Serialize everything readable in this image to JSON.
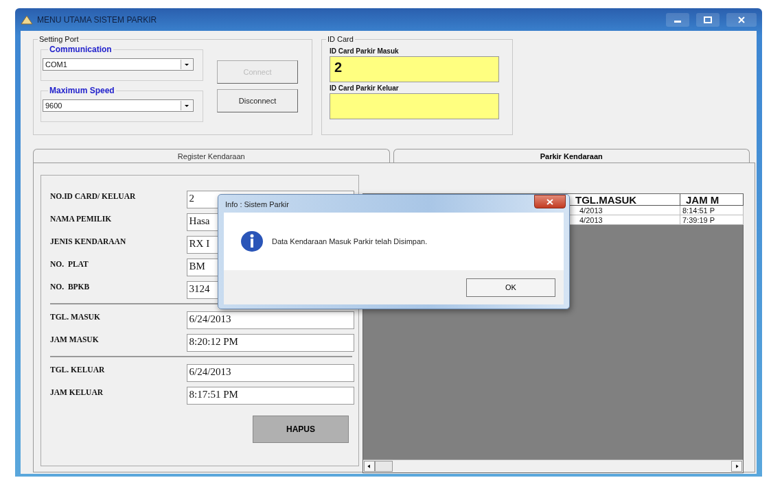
{
  "window": {
    "title": "MENU UTAMA SISTEM PARKIR"
  },
  "setting_port": {
    "title": "Setting Port",
    "communication": {
      "label": "Communication",
      "value": "COM1"
    },
    "maximum_speed": {
      "label": "Maximum Speed",
      "value": "9600"
    },
    "buttons": [
      {
        "label": "Connect",
        "disabled": true
      },
      {
        "label": "Disconnect",
        "disabled": false
      }
    ]
  },
  "id_card": {
    "title": "ID Card",
    "fields": [
      {
        "label": "ID Card Parkir Masuk",
        "value": "2"
      },
      {
        "label": "ID Card Parkir Keluar"
      }
    ]
  },
  "tabs": [
    {
      "label": "Register Kendaraan",
      "selected": false
    },
    {
      "label": "Parkir Kendaraan",
      "selected": true
    }
  ],
  "form": {
    "sections": [
      [
        {
          "label": "NO.ID CARD/ KELUAR",
          "value": "2"
        },
        {
          "label": "NAMA PEMILIK",
          "value": "Hasa"
        },
        {
          "label": "JENIS KENDARAAN",
          "value": "RX I"
        },
        {
          "label": "NO.  PLAT",
          "value": "BM"
        },
        {
          "label": "NO.  BPKB",
          "value": "3124"
        }
      ],
      [
        {
          "label": "TGL. MASUK",
          "value": "6/24/2013"
        },
        {
          "label": "JAM MASUK",
          "value": "8:20:12 PM"
        }
      ],
      [
        {
          "label": "TGL. KELUAR",
          "value": "6/24/2013"
        },
        {
          "label": "JAM KELUAR",
          "value": "8:17:51 PM"
        }
      ]
    ],
    "button": "HAPUS"
  },
  "table": {
    "columns": [
      "TGL.MASUK",
      "JAM M"
    ],
    "rows": [
      [
        "4/2013",
        "8:14:51 P"
      ],
      [
        "4/2013",
        "7:39:19 P"
      ]
    ]
  },
  "dialog": {
    "title": "Info : Sistem Parkir",
    "message": "Data Kendaraan Masuk Parkir telah Disimpan.",
    "button": "OK"
  }
}
